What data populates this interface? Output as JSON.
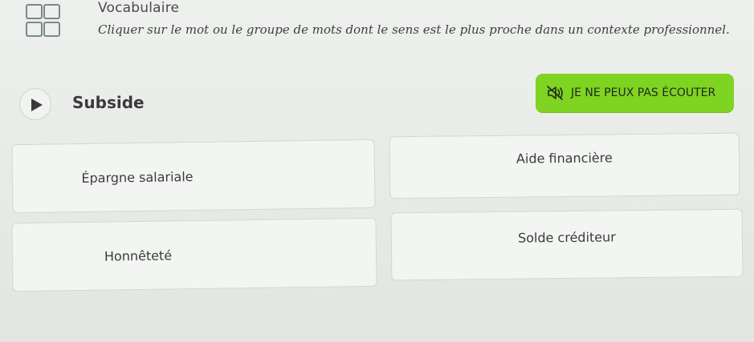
{
  "header": {
    "title": "Vocabulaire",
    "instruction": "Cliquer sur le mot ou le groupe de mots dont le sens est le plus proche dans un contexte professionnel.",
    "icon": "grid-icon"
  },
  "prompt": {
    "play_icon": "play-icon",
    "word": "Subside"
  },
  "cant_listen": {
    "label": "JE NE PEUX PAS ÉCOUTER",
    "icon": "speaker-muted-icon",
    "color": "#7fd321"
  },
  "options": [
    {
      "label": "Épargne salariale"
    },
    {
      "label": "Aide financière"
    },
    {
      "label": "Honnêteté"
    },
    {
      "label": "Solde créditeur"
    }
  ]
}
